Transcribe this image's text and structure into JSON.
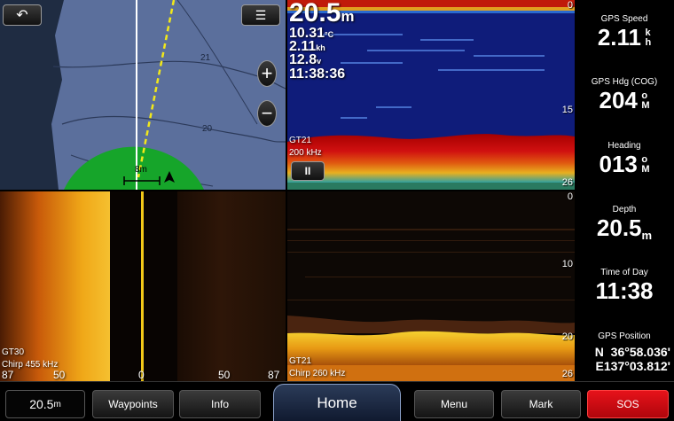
{
  "chart": {
    "back_icon": "back-arrow-icon",
    "menu_icon": "layer-menu-icon",
    "zoom_in": "+",
    "zoom_out": "−",
    "contour_labels": [
      "21",
      "20"
    ],
    "scale_label": "8m"
  },
  "sonar_top": {
    "depth": "20.5",
    "depth_unit": "m",
    "temp": "10.31",
    "temp_unit": "°C",
    "speed": "2.11",
    "speed_unit": "kh",
    "voltage": "12.8",
    "voltage_unit": "v",
    "time": "11:38:36",
    "transducer": "GT21",
    "frequency": "200 kHz",
    "pause_label": "II",
    "scale": [
      "0",
      "15",
      "26"
    ]
  },
  "side_view": {
    "transducer": "GT30",
    "frequency": "Chirp 455 kHz",
    "range_labels": [
      "87",
      "50",
      "0",
      "50",
      "87"
    ]
  },
  "sonar_bottom": {
    "transducer": "GT21",
    "frequency": "Chirp 260 kHz",
    "scale": [
      "0",
      "10",
      "20",
      "26"
    ]
  },
  "sidebar": {
    "fields": [
      {
        "label": "GPS Speed",
        "value": "2.11",
        "unit_top": "k",
        "unit_bot": "h"
      },
      {
        "label": "GPS Hdg (COG)",
        "value": "204",
        "unit_top": "o",
        "unit_bot": "M"
      },
      {
        "label": "Heading",
        "value": "013",
        "unit_top": "o",
        "unit_bot": "M"
      },
      {
        "label": "Depth",
        "value": "20.5",
        "unit": "m"
      },
      {
        "label": "Time of Day",
        "value": "11:38"
      }
    ],
    "gps_label": "GPS Position",
    "lat": "N  36°58.036'",
    "lon": "E137°03.812'"
  },
  "bottom": {
    "depth_value": "20.5",
    "depth_unit": "m",
    "waypoints": "Waypoints",
    "info": "Info",
    "home": "Home",
    "menu": "Menu",
    "mark": "Mark",
    "sos": "SOS"
  },
  "colors": {
    "sos": "#e6121a",
    "sonar_bg": "#0f1c7a",
    "chart_water": "#5b6f9c",
    "range_ring": "#16a52a",
    "track": "#f2e81a"
  }
}
